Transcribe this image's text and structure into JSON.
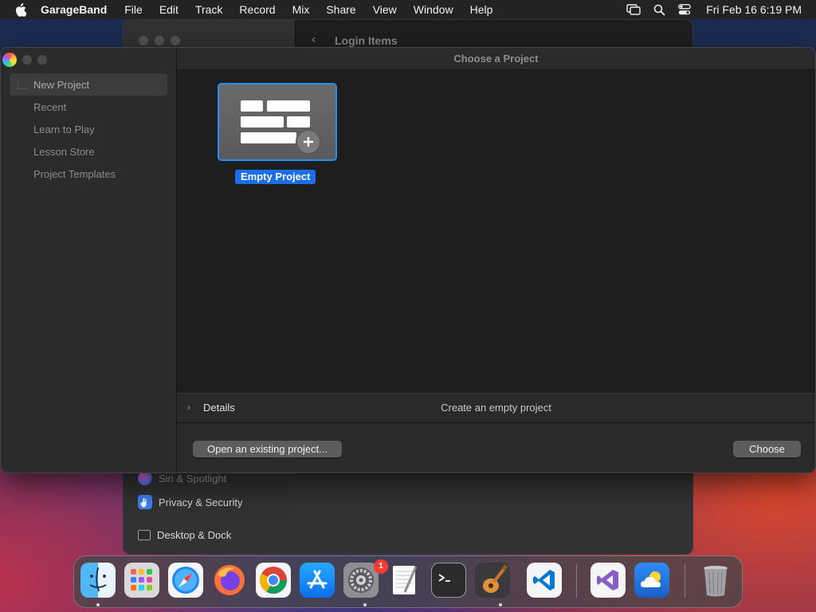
{
  "menubar": {
    "app_name": "GarageBand",
    "menus": [
      "File",
      "Edit",
      "Track",
      "Record",
      "Mix",
      "Share",
      "View",
      "Window",
      "Help"
    ],
    "status_icons": [
      "screen-mirroring-icon",
      "search-icon",
      "control-center-icon"
    ],
    "clock": "Fri Feb 16  6:19 PM"
  },
  "background_window": {
    "title": "Login Items",
    "sidebar_items": [
      {
        "label": "Siri & Spotlight",
        "icon": "siri-icon"
      },
      {
        "label": "Privacy & Security",
        "icon": "hand-icon"
      },
      {
        "label": "Desktop & Dock",
        "icon": "dock-icon"
      }
    ]
  },
  "window": {
    "title": "Choose a Project",
    "sidebar": [
      {
        "label": "New Project",
        "selected": true
      },
      {
        "label": "Recent",
        "selected": false
      },
      {
        "label": "Learn to Play",
        "selected": false
      },
      {
        "label": "Lesson Store",
        "selected": false
      },
      {
        "label": "Project Templates",
        "selected": false
      }
    ],
    "tile": {
      "label": "Empty Project",
      "icon": "empty-project-icon"
    },
    "details": {
      "label": "Details",
      "description": "Create an empty project"
    },
    "buttons": {
      "open": "Open an existing project...",
      "choose": "Choose"
    }
  },
  "dock": {
    "apps": [
      {
        "name": "finder-icon",
        "running": true
      },
      {
        "name": "launchpad-icon",
        "running": false
      },
      {
        "name": "safari-icon",
        "running": false
      },
      {
        "name": "firefox-icon",
        "running": false
      },
      {
        "name": "chrome-icon",
        "running": false
      },
      {
        "name": "app-store-icon",
        "running": false
      },
      {
        "name": "system-settings-icon",
        "running": true,
        "badge": "1"
      },
      {
        "name": "textedit-icon",
        "running": false
      },
      {
        "name": "terminal-icon",
        "running": false
      },
      {
        "name": "garageband-icon",
        "running": true
      },
      {
        "name": "vscode-icon",
        "running": false
      },
      {
        "name": "visual-studio-icon",
        "running": false
      },
      {
        "name": "weather-icon",
        "running": false
      },
      {
        "name": "trash-icon",
        "running": false
      }
    ]
  },
  "colors": {
    "accent": "#2a8cf8",
    "label_accent": "#1b6ee8",
    "badge": "#ff3b30"
  }
}
